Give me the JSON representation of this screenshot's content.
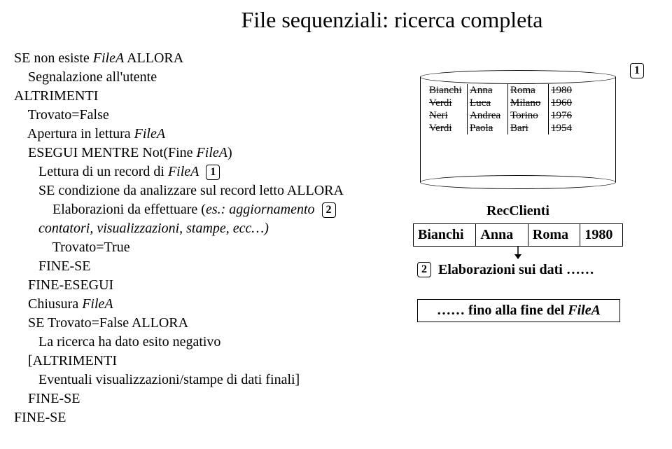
{
  "title": "File sequenziali: ricerca completa",
  "box_labels": {
    "one": "1",
    "two": "2"
  },
  "code": {
    "l01a": "SE non esiste ",
    "l01b": "FileA",
    "l01c": " ALLORA",
    "l02": "    Segnalazione all'utente",
    "l03": "ALTRIMENTI",
    "l04": "    Trovato=False",
    "l05a": "    Apertura in lettura ",
    "l05b": "FileA",
    "l06a": "    ESEGUI MENTRE Not(Fine ",
    "l06b": "FileA",
    "l06c": ")",
    "l07a": "       Lettura di un record di ",
    "l07b": "FileA",
    "l08": "       SE condizione da analizzare sul record letto ALLORA",
    "l09a": "           Elaborazioni da effettuare (",
    "l09b": "es.: aggiornamento",
    "l10": "       contatori, visualizzazioni, stampe, ecc…)",
    "l11": "           Trovato=True",
    "l12": "       FINE-SE",
    "l13": "    FINE-ESEGUI",
    "l14a": "    Chiusura ",
    "l14b": "FileA",
    "l15": "    SE Trovato=False ALLORA",
    "l16": "       La ricerca ha dato esito negativo",
    "l17": "    [ALTRIMENTI",
    "l18": "       Eventuali visualizzazioni/stampe di dati finali]",
    "l19": "    FINE-SE",
    "l20": "FINE-SE"
  },
  "db": {
    "rows": [
      {
        "c1": "Bianchi",
        "c2": "Anna",
        "c3": "Roma",
        "c4": "1980"
      },
      {
        "c1": "Verdi",
        "c2": "Luca",
        "c3": "Milano",
        "c4": "1960"
      },
      {
        "c1": "Neri",
        "c2": "Andrea",
        "c3": "Torino",
        "c4": "1976"
      },
      {
        "c1": "Verdi",
        "c2": "Paola",
        "c3": "Bari",
        "c4": "1954"
      }
    ]
  },
  "rec_label": "RecClienti",
  "rec_row": {
    "c1": "Bianchi",
    "c2": "Anna",
    "c3": "Roma",
    "c4": "1980"
  },
  "elab_text": "Elaborazioni sui dati ……",
  "last_box_a": "…… fino alla fine del ",
  "last_box_b": "FileA"
}
